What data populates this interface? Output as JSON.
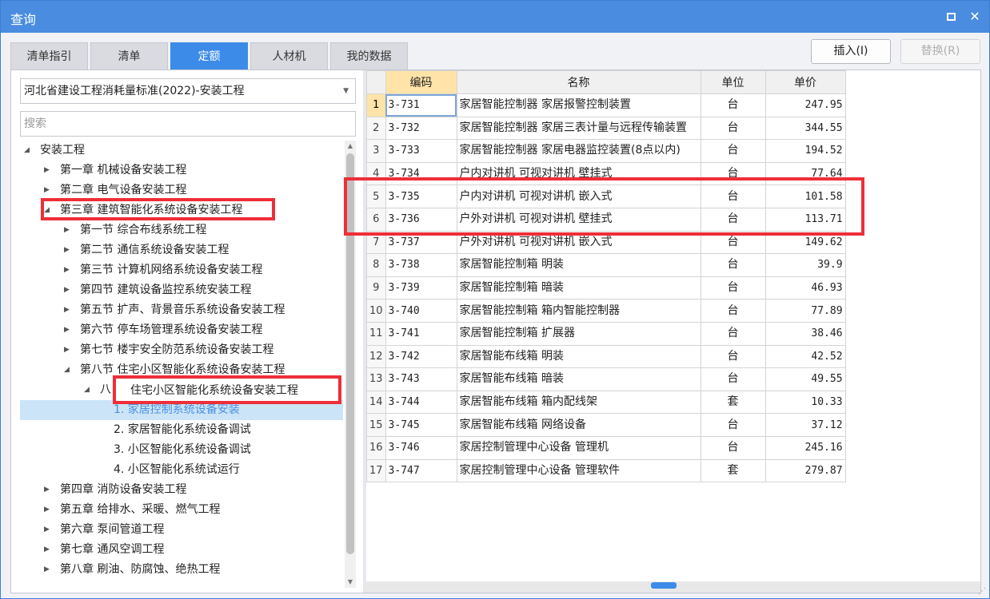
{
  "window": {
    "title": "查询"
  },
  "tabs": [
    {
      "label": "清单指引",
      "active": false
    },
    {
      "label": "清单",
      "active": false
    },
    {
      "label": "定额",
      "active": true
    },
    {
      "label": "人材机",
      "active": false
    },
    {
      "label": "我的数据",
      "active": false
    }
  ],
  "buttons": {
    "insert": "插入(I)",
    "replace": "替换(R)"
  },
  "library": {
    "selected": "河北省建设工程消耗量标准(2022)-安装工程"
  },
  "search": {
    "placeholder": "搜索"
  },
  "tree": [
    {
      "label": "安装工程",
      "level": 0,
      "state": "expanded"
    },
    {
      "label": "第一章 机械设备安装工程",
      "level": 1,
      "state": "collapsed"
    },
    {
      "label": "第二章 电气设备安装工程",
      "level": 1,
      "state": "collapsed"
    },
    {
      "label": "第三章 建筑智能化系统设备安装工程",
      "level": 1,
      "state": "expanded"
    },
    {
      "label": "第一节 综合布线系统工程",
      "level": 2,
      "state": "collapsed"
    },
    {
      "label": "第二节 通信系统设备安装工程",
      "level": 2,
      "state": "collapsed"
    },
    {
      "label": "第三节 计算机网络系统设备安装工程",
      "level": 2,
      "state": "collapsed"
    },
    {
      "label": "第四节 建筑设备监控系统安装工程",
      "level": 2,
      "state": "collapsed"
    },
    {
      "label": "第五节 扩声、背景音乐系统设备安装工程",
      "level": 2,
      "state": "collapsed"
    },
    {
      "label": "第六节 停车场管理系统设备安装工程",
      "level": 2,
      "state": "collapsed"
    },
    {
      "label": "第七节 楼宇安全防范系统设备安装工程",
      "level": 2,
      "state": "collapsed"
    },
    {
      "label": "第八节 住宅小区智能化系统设备安装工程",
      "level": 2,
      "state": "expanded"
    },
    {
      "label": "八",
      "level": 3,
      "state": "expanded"
    },
    {
      "label": "1. 家居控制系统设备安装",
      "level": 4,
      "state": "leaf",
      "selected": true
    },
    {
      "label": "2. 家居智能化系统设备调试",
      "level": 4,
      "state": "leaf"
    },
    {
      "label": "3. 小区智能化系统设备调试",
      "level": 4,
      "state": "leaf"
    },
    {
      "label": "4. 小区智能化系统试运行",
      "level": 4,
      "state": "leaf"
    },
    {
      "label": "第四章 消防设备安装工程",
      "level": 1,
      "state": "collapsed"
    },
    {
      "label": "第五章 给排水、采暖、燃气工程",
      "level": 1,
      "state": "collapsed"
    },
    {
      "label": "第六章 泵间管道工程",
      "level": 1,
      "state": "collapsed"
    },
    {
      "label": "第七章 通风空调工程",
      "level": 1,
      "state": "collapsed"
    },
    {
      "label": "第八章 刷油、防腐蚀、绝热工程",
      "level": 1,
      "state": "collapsed"
    }
  ],
  "tooltip": {
    "text": "住宅小区智能化系统设备安装工程"
  },
  "grid": {
    "columns": [
      "编码",
      "名称",
      "单位",
      "单价"
    ],
    "rows": [
      {
        "n": "1",
        "code": "3-731",
        "name": "家居智能控制器 家居报警控制装置",
        "unit": "台",
        "price": "247.95"
      },
      {
        "n": "2",
        "code": "3-732",
        "name": "家居智能控制器 家居三表计量与远程传输装置",
        "unit": "台",
        "price": "344.55"
      },
      {
        "n": "3",
        "code": "3-733",
        "name": "家居智能控制器 家居电器监控装置(8点以内)",
        "unit": "台",
        "price": "194.52"
      },
      {
        "n": "4",
        "code": "3-734",
        "name": "户内对讲机 可视对讲机 壁挂式",
        "unit": "台",
        "price": "77.64"
      },
      {
        "n": "5",
        "code": "3-735",
        "name": "户内对讲机 可视对讲机 嵌入式",
        "unit": "台",
        "price": "101.58"
      },
      {
        "n": "6",
        "code": "3-736",
        "name": "户外对讲机 可视对讲机 壁挂式",
        "unit": "台",
        "price": "113.71"
      },
      {
        "n": "7",
        "code": "3-737",
        "name": "户外对讲机 可视对讲机 嵌入式",
        "unit": "台",
        "price": "149.62"
      },
      {
        "n": "8",
        "code": "3-738",
        "name": "家居智能控制箱 明装",
        "unit": "台",
        "price": "39.9"
      },
      {
        "n": "9",
        "code": "3-739",
        "name": "家居智能控制箱 暗装",
        "unit": "台",
        "price": "46.93"
      },
      {
        "n": "10",
        "code": "3-740",
        "name": "家居智能控制箱 箱内智能控制器",
        "unit": "台",
        "price": "77.89"
      },
      {
        "n": "11",
        "code": "3-741",
        "name": "家居智能控制箱 扩展器",
        "unit": "台",
        "price": "38.46"
      },
      {
        "n": "12",
        "code": "3-742",
        "name": "家居智能布线箱 明装",
        "unit": "台",
        "price": "42.52"
      },
      {
        "n": "13",
        "code": "3-743",
        "name": "家居智能布线箱 暗装",
        "unit": "台",
        "price": "49.55"
      },
      {
        "n": "14",
        "code": "3-744",
        "name": "家居智能布线箱 箱内配线架",
        "unit": "套",
        "price": "10.33"
      },
      {
        "n": "15",
        "code": "3-745",
        "name": "家居智能布线箱 网络设备",
        "unit": "台",
        "price": "37.12"
      },
      {
        "n": "16",
        "code": "3-746",
        "name": "家居控制管理中心设备 管理机",
        "unit": "台",
        "price": "245.16"
      },
      {
        "n": "17",
        "code": "3-747",
        "name": "家居控制管理中心设备 管理软件",
        "unit": "套",
        "price": "279.87"
      }
    ]
  },
  "colors": {
    "accent": "#3d8be8",
    "title_bar": "#4a8ce0",
    "highlight_box": "#ee2e38",
    "header_highlight": "#ffe3a8"
  },
  "icons": {
    "maximize": "restore-icon",
    "close": "close-icon",
    "dropdown": "chevron-down-icon",
    "expanded": "triangle-down-icon",
    "collapsed": "triangle-right-icon"
  }
}
